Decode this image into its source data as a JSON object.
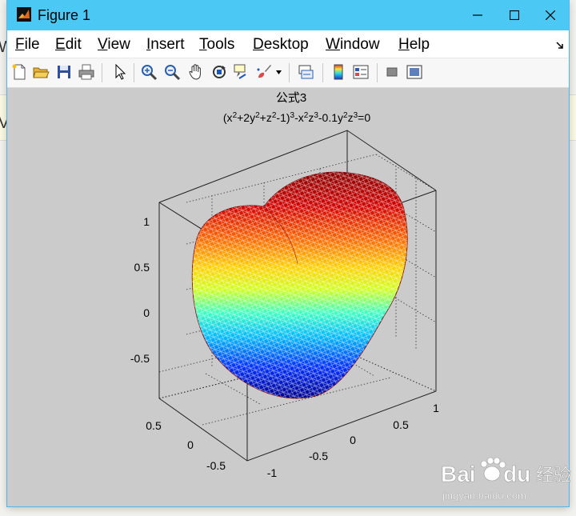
{
  "window": {
    "title": "Figure 1"
  },
  "background": {
    "left_letter_1": "W",
    "left_letter_2": "V"
  },
  "menubar": {
    "items": [
      {
        "label": "File",
        "accel": "F",
        "rest": "ile"
      },
      {
        "label": "Edit",
        "accel": "E",
        "rest": "dit"
      },
      {
        "label": "View",
        "accel": "V",
        "rest": "iew"
      },
      {
        "label": "Insert",
        "accel": "I",
        "rest": "nsert"
      },
      {
        "label": "Tools",
        "accel": "T",
        "rest": "ools"
      },
      {
        "label": "Desktop",
        "accel": "D",
        "rest": "esktop"
      },
      {
        "label": "Window",
        "accel": "W",
        "rest": "indow"
      },
      {
        "label": "Help",
        "accel": "H",
        "rest": "elp"
      }
    ]
  },
  "toolbar": {
    "buttons": [
      "new-figure-icon",
      "open-file-icon",
      "save-icon",
      "print-icon",
      "pointer-icon",
      "zoom-in-icon",
      "zoom-out-icon",
      "pan-hand-icon",
      "rotate-3d-icon",
      "data-cursor-icon",
      "brush-icon",
      "link-plot-icon",
      "colorbar-icon",
      "legend-icon",
      "hide-plot-tools-icon",
      "show-plot-tools-icon"
    ]
  },
  "figure": {
    "title": "公式3",
    "equation_parts": {
      "p1": "(x",
      "s1": "2",
      "p2": "+2y",
      "s2": "2",
      "p3": "+z",
      "s3": "2",
      "p4": "-1)",
      "s4": "3",
      "p5": "-x",
      "s5": "2",
      "p6": "z",
      "s6": "3",
      "p7": "-0.1y",
      "s7": "2",
      "p8": "z",
      "s8": "3",
      "p9": "=0"
    },
    "z_ticks": [
      "1",
      "0.5",
      "0",
      "-0.5"
    ],
    "x_ticks": [
      "0.5",
      "0",
      "-0.5"
    ],
    "y_ticks": [
      "-1",
      "-0.5",
      "0",
      "0.5",
      "1"
    ]
  },
  "watermark": {
    "brand": "Bai",
    "brand2": "du",
    "cn": "经验",
    "url": "jingyan.baidu.com"
  },
  "colors": {
    "titlebar": "#4cc8f5",
    "canvas": "#cbcbcb",
    "surface_top": "#8b0000",
    "surface_bottom": "#00008b"
  }
}
